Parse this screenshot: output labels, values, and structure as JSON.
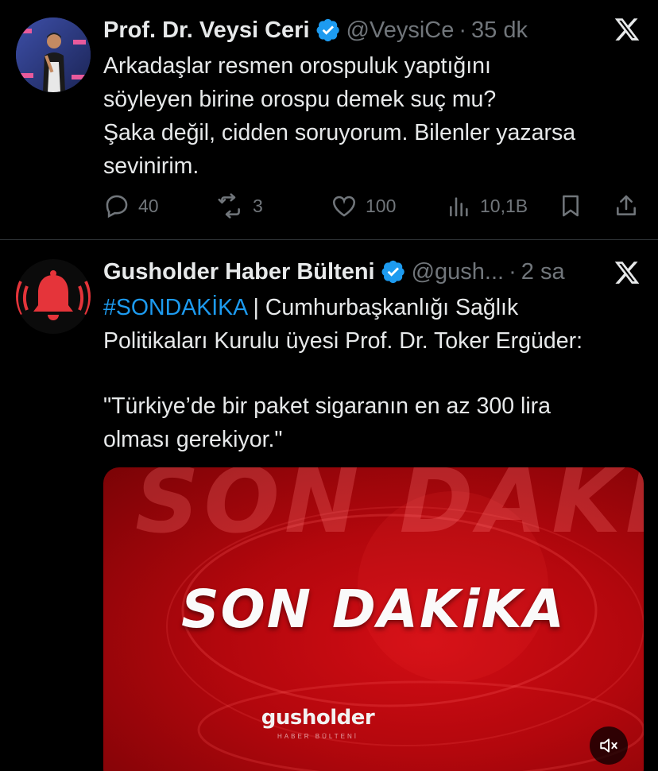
{
  "tweets": [
    {
      "author_name": "Prof. Dr. Veysi Ceri",
      "author_handle": "@VeysiCe",
      "separator": "·",
      "time": "35 dk",
      "avatar_icon": "person-avatar",
      "lines": [
        "Arkadaşlar resmen orospuluk yaptığını",
        "söyleyen birine orospu demek suç mu?",
        "Şaka değil, cidden soruyorum. Bilenler yazarsa",
        "sevinirim."
      ],
      "actions": {
        "replies": "40",
        "reposts": "3",
        "likes": "100",
        "views": "10,1B"
      }
    },
    {
      "author_name": "Gusholder Haber Bülteni",
      "author_handle": "@gush...",
      "separator": "·",
      "time": "2 sa",
      "avatar_icon": "bell-alert-avatar",
      "hashtag": "#SONDAKİKA",
      "line1_rest": " | Cumhurbaşkanlığı Sağlık",
      "line2": "Politikaları Kurulu üyesi Prof. Dr. Toker Ergüder:",
      "quote_line1": "\"Türkiye’de bir paket sigaranın en az 300 lira",
      "quote_line2": "olması gerekiyor.\"",
      "media": {
        "bg_text": "SON DAKİ",
        "headline": "SON DAKiKA",
        "brand": "gusholder",
        "brand_sub": "HABER BÜLTENİ"
      }
    }
  ],
  "colors": {
    "background": "#000000",
    "text": "#e7e9ea",
    "muted": "#71767b",
    "link": "#1d9bf0",
    "divider": "#2f3336",
    "media_red": "#c90a12"
  }
}
